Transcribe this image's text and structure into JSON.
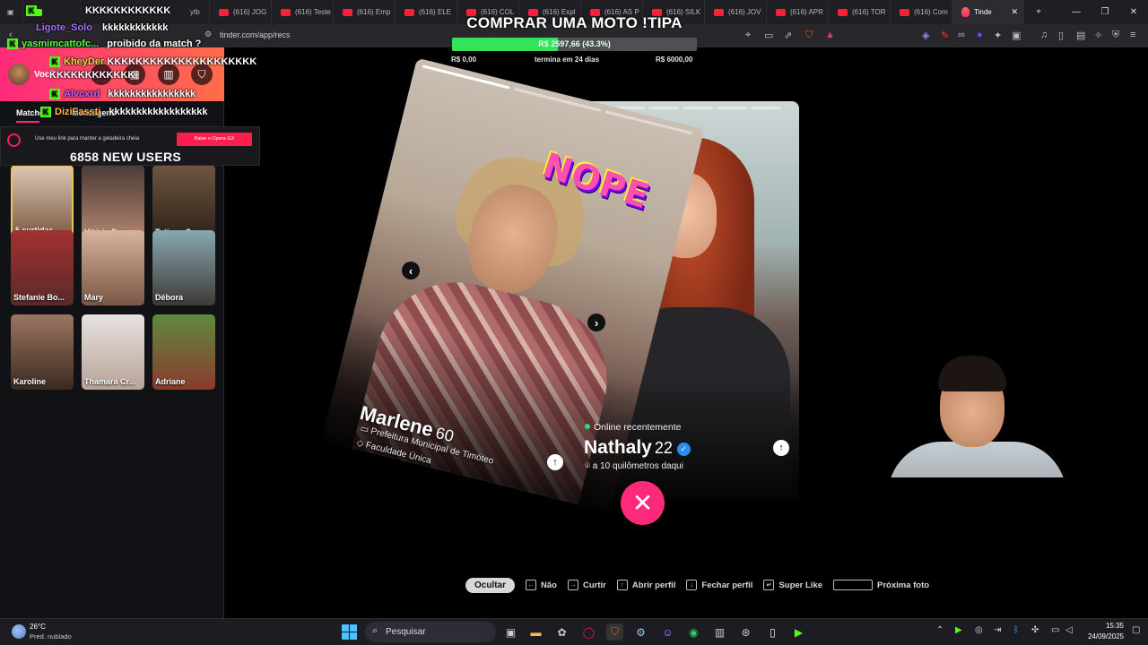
{
  "browser": {
    "tabs": [
      {
        "label": "(616) JOG"
      },
      {
        "label": "(616) Teste"
      },
      {
        "label": "(616) Emp"
      },
      {
        "label": "(616) ELE"
      },
      {
        "label": "(616) COL"
      },
      {
        "label": "(616) Expl"
      },
      {
        "label": "(616) AS P"
      },
      {
        "label": "(616) SILK"
      },
      {
        "label": "(616) JOV"
      },
      {
        "label": "(616) APR"
      },
      {
        "label": "(616) TOR"
      },
      {
        "label": "(616) Com"
      }
    ],
    "active_tab": "Tinde",
    "url": "tinder.com/app/recs",
    "first_tab": "ytb"
  },
  "goal": {
    "title": "COMPRAR UMA MOTO !TIPA",
    "current": "R$ 2597,66 (43.3%)",
    "progress": 0.433,
    "min_label": "R$ 0,00",
    "ends": "termina em 24 dias",
    "max_label": "R$ 6000,00",
    "fill_color": "#35e25b"
  },
  "chat": [
    {
      "user": "Ligote_Solo",
      "text": "kkkkkkkkkkkk"
    },
    {
      "user": "yasmimcattofc...",
      "text": "proibido da match ?"
    },
    {
      "user": "KheyDer",
      "text": "KKKKKKKKKKKKKKKKKKKKKKKKKKKKKKKKK"
    },
    {
      "user": "Alvcxrd",
      "text": "kkkkkkkkkkkkkkkk"
    },
    {
      "user": "DiziFassti",
      "text": "kkkkkkkkkkkkkkkkkk"
    }
  ],
  "chat_top": "KKKKKKKKKKKK",
  "sidebar": {
    "me_label": "Você",
    "tabs": {
      "matches": "Matches",
      "messages": "Mensagens"
    },
    "matches": [
      {
        "name": "5 curtidas"
      },
      {
        "name": "Vitória Ferr..."
      },
      {
        "name": "Tatiane Gon..."
      },
      {
        "name": "Stefanie Bo..."
      },
      {
        "name": "Mary"
      },
      {
        "name": "Débora"
      },
      {
        "name": "Karoline"
      },
      {
        "name": "Thamara Cr..."
      },
      {
        "name": "Adriane"
      }
    ]
  },
  "ad": {
    "text": "Use meu link para manter a geladeira cheia",
    "button": "Baixe o Opera GX"
  },
  "new_users": "6858 NEW USERS",
  "profiles": {
    "left": {
      "stamp": "NOPE",
      "name": "Marlene",
      "age": "60",
      "work": "Prefeitura Municipal de Timóteo",
      "school": "Faculdade Única"
    },
    "right": {
      "status": "Online recentemente",
      "name": "Nathaly",
      "age": "22",
      "distance": "a 10 quilômetros daqui"
    }
  },
  "hints": {
    "hide": "Ocultar",
    "no": "Não",
    "like": "Curtir",
    "open_profile": "Abrir perfil",
    "close_profile": "Fechar perfil",
    "super_like": "Super Like",
    "next_photo": "Próxima foto"
  },
  "taskbar": {
    "temp": "26°C",
    "weather": "Pred. nublado",
    "search": "Pesquisar",
    "time": "15:35",
    "date": "24/09/2025"
  }
}
